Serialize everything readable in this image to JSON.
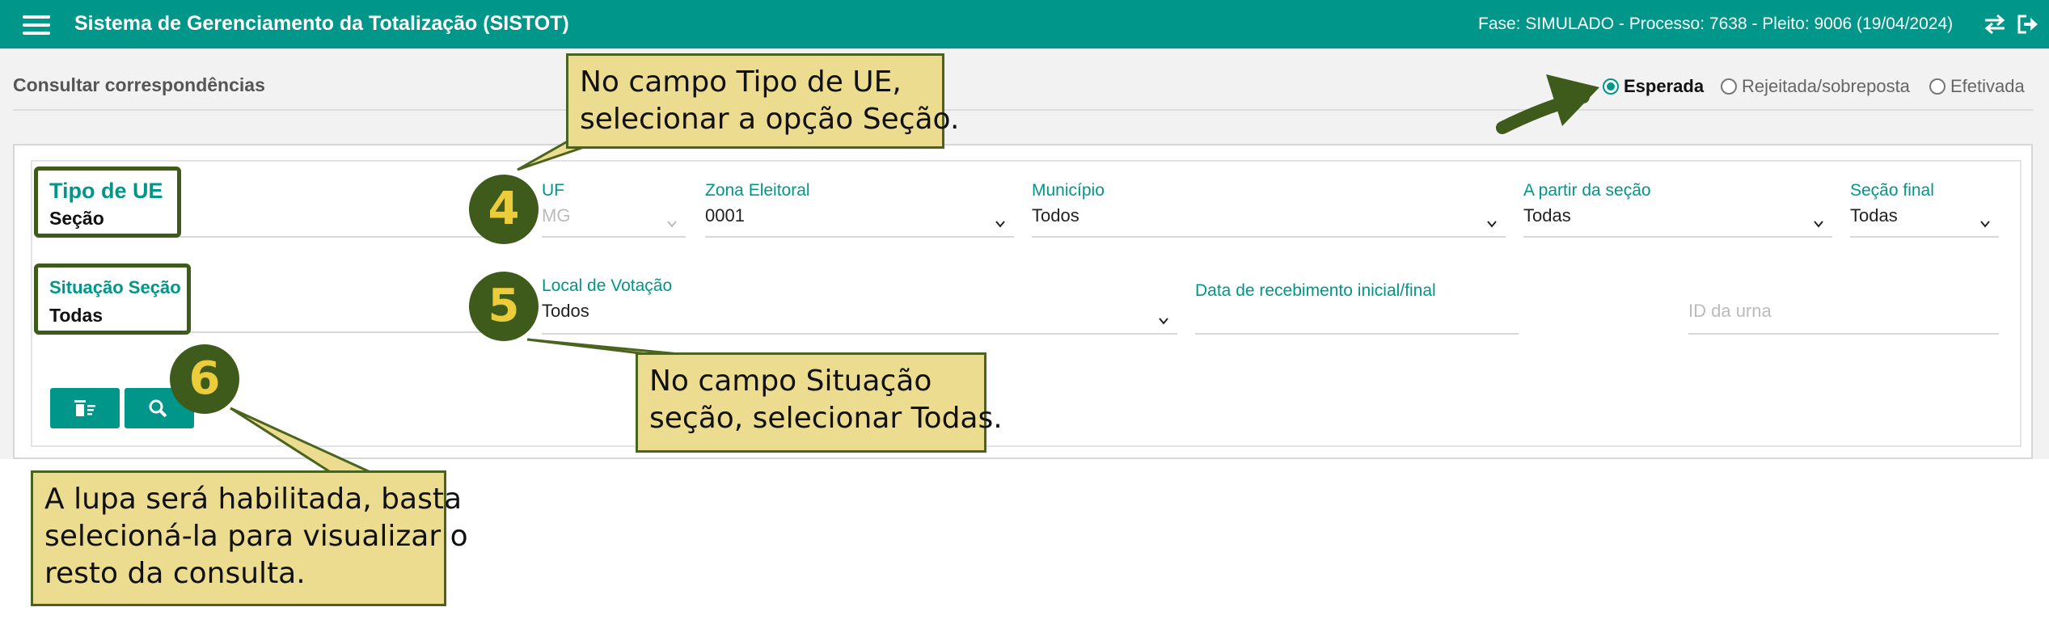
{
  "header": {
    "title": "Sistema de Gerenciamento da Totalização (SISTOT)",
    "phase": "Fase: SIMULADO - Processo: 7638 - Pleito: 9006 (19/04/2024)",
    "menu_icon": "hamburger-menu-icon",
    "sync_icon": "swap-arrows-icon",
    "logout_icon": "logout-icon"
  },
  "page": {
    "title": "Consultar correspondências",
    "status_options": [
      {
        "label": "Esperada",
        "selected": true
      },
      {
        "label": "Rejeitada/sobreposta",
        "selected": false
      },
      {
        "label": "Efetivada",
        "selected": false
      }
    ]
  },
  "form": {
    "tipo_ue": {
      "label": "Tipo de UE",
      "value": "Seção"
    },
    "uf": {
      "label": "UF",
      "value": "MG"
    },
    "zona": {
      "label": "Zona Eleitoral",
      "value": "0001"
    },
    "municipio": {
      "label": "Município",
      "value": "Todos"
    },
    "secao_inicial": {
      "label": "A partir da seção",
      "value": "Todas"
    },
    "secao_final": {
      "label": "Seção final",
      "value": "Todas"
    },
    "situacao_secao": {
      "label": "Situação Seção",
      "value": "Todas"
    },
    "local_votacao": {
      "label": "Local de Votação",
      "value": "Todos"
    },
    "data_recebimento": {
      "label": "Data de recebimento inicial/final",
      "value": ""
    },
    "id_urna": {
      "placeholder": "ID da urna"
    },
    "clear_icon": "clear-filter-icon",
    "search_icon": "search-icon"
  },
  "annotations": {
    "step4": {
      "number": "4",
      "text_line1": "No campo Tipo de UE,",
      "text_line2": "selecionar a opção Seção."
    },
    "step5": {
      "number": "5",
      "text_line1": "No campo Situação",
      "text_line2": "seção, selecionar Todas."
    },
    "step6": {
      "number": "6",
      "text_line1": "A lupa será habilitada, basta",
      "text_line2": "selecioná-la para visualizar o",
      "text_line3": "resto da consulta."
    },
    "arrow_color": "#3e5b1b",
    "callout_color": "#ebdc8f"
  },
  "colors": {
    "primary": "#00968a",
    "annotation_dark": "#3e5b1b",
    "annotation_gold": "#ebcc3a"
  }
}
